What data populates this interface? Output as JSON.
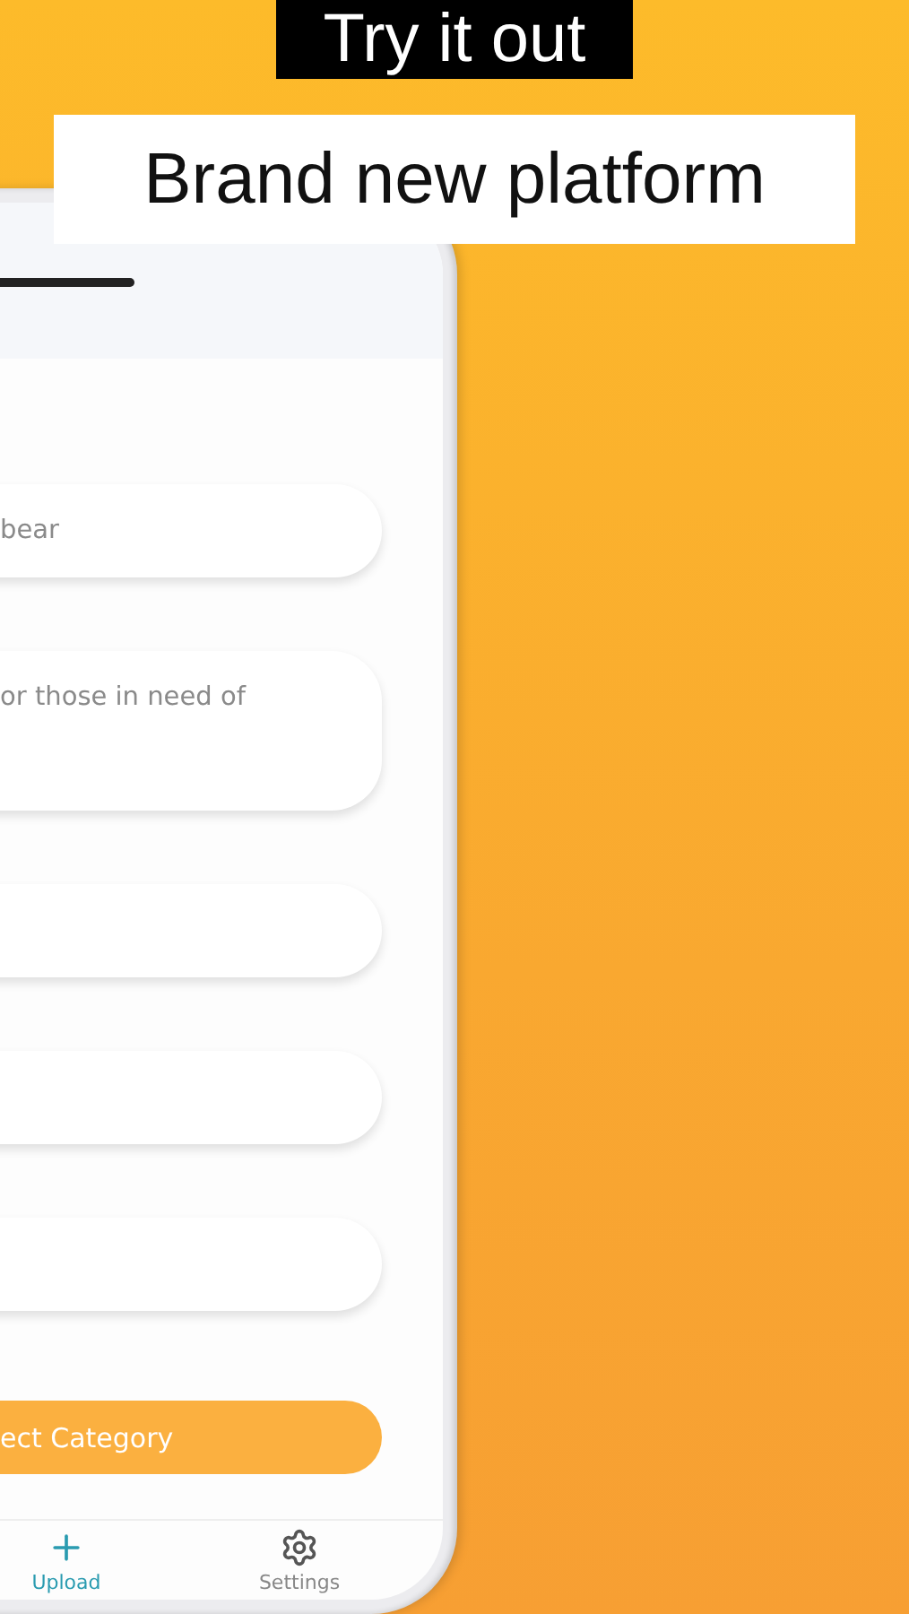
{
  "banner": {
    "title": "Try it out",
    "subtitle": "Brand new platform"
  },
  "form": {
    "fields": [
      {
        "kind": "line",
        "placeholder": "bear"
      },
      {
        "kind": "area",
        "placeholder": "or those in need of"
      },
      {
        "kind": "line"
      },
      {
        "kind": "line"
      },
      {
        "kind": "line"
      }
    ],
    "button": "ect Category"
  },
  "tabs": [
    {
      "kind": "plus",
      "label": "Upload",
      "selected": true
    },
    {
      "kind": "gear",
      "label": "Settings",
      "selected": false
    }
  ]
}
